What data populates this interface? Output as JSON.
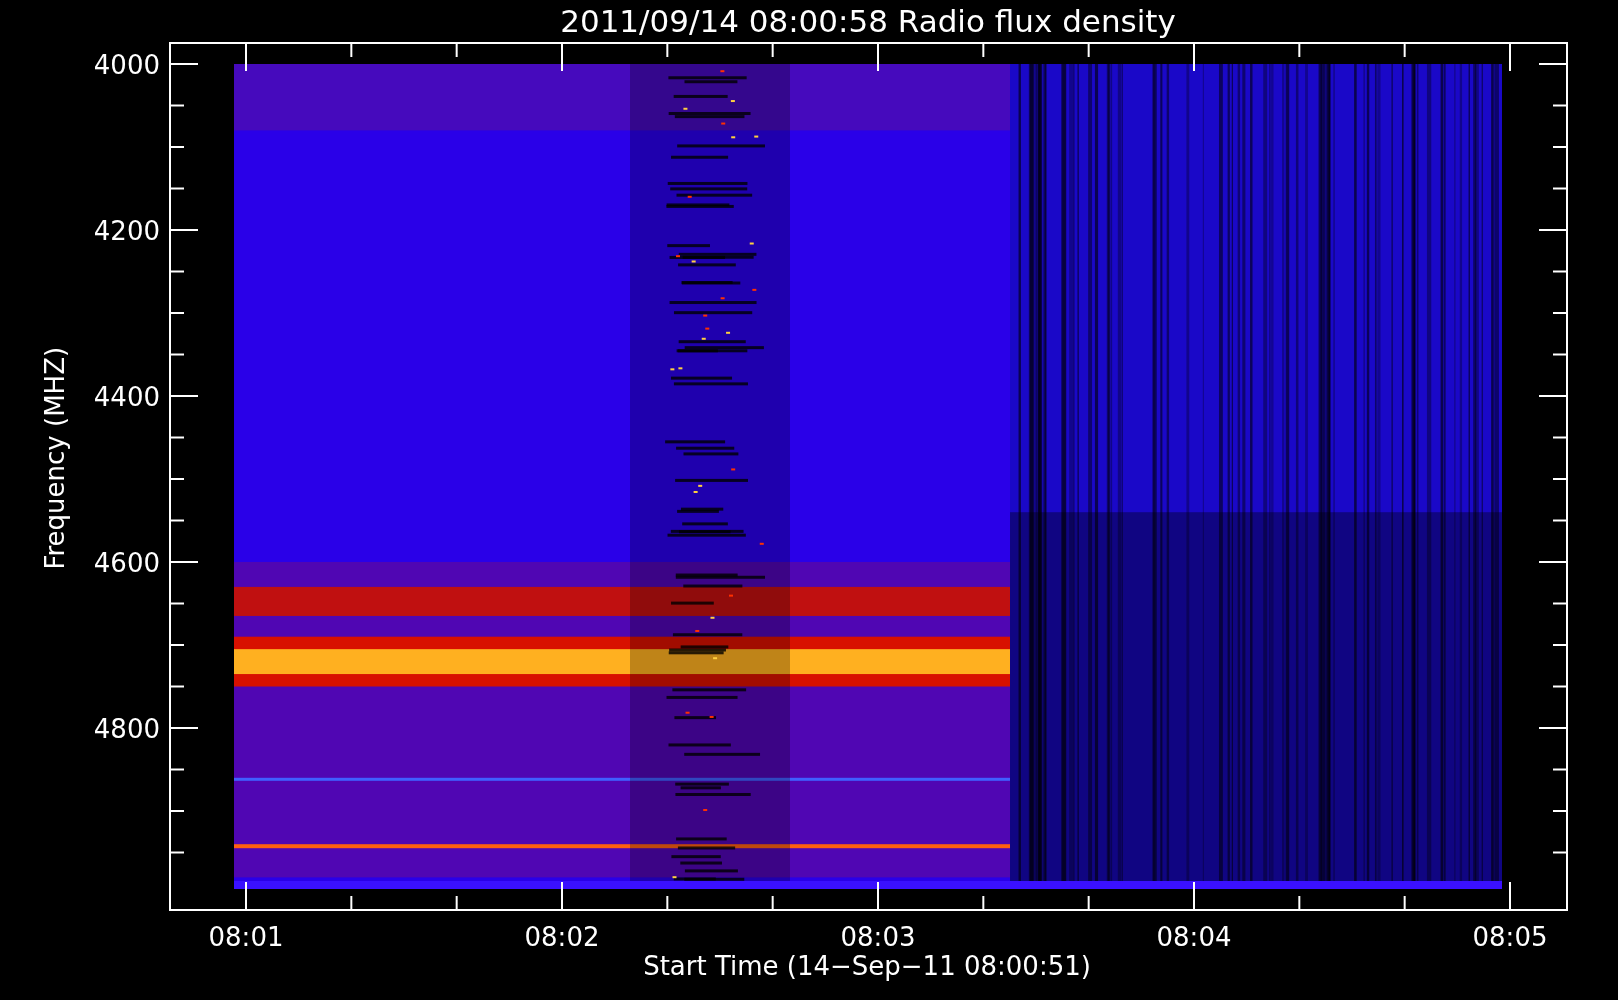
{
  "title": "2011/09/14 08:00:58 Radio flux density",
  "y_axis": {
    "label": "Frequency (MHZ)",
    "ticks": [
      "4000",
      "4200",
      "4400",
      "4600",
      "4800"
    ]
  },
  "x_axis": {
    "label": "Start Time (14−Sep−11 08:00:51)",
    "ticks": [
      "08:01",
      "08:02",
      "08:03",
      "08:04",
      "08:05"
    ]
  }
}
